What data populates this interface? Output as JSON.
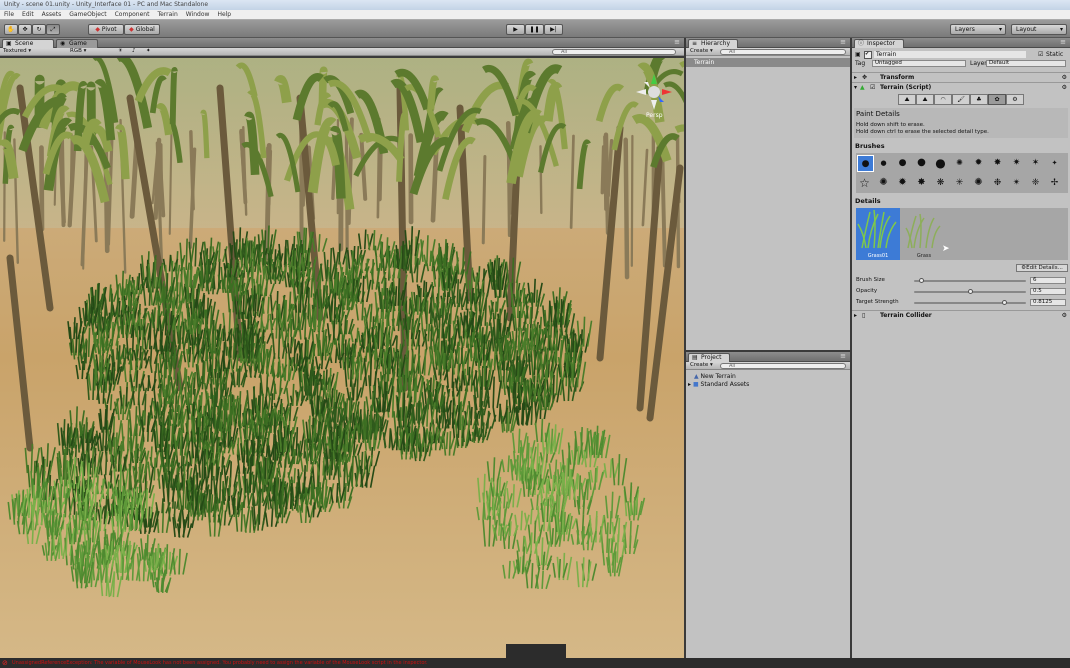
{
  "window": {
    "title": "Unity - scene 01.unity - Unity_Interface 01 - PC and Mac Standalone"
  },
  "menu": [
    "File",
    "Edit",
    "Assets",
    "GameObject",
    "Component",
    "Terrain",
    "Window",
    "Help"
  ],
  "toolbar": {
    "pivot": "Pivot",
    "global": "Global",
    "layers": "Layers",
    "layout": "Layout"
  },
  "scene": {
    "tab_scene": "Scene",
    "tab_game": "Game",
    "render_mode": "Textured",
    "color_mode": "RGB",
    "search_placeholder": "All",
    "gizmo_label": "Persp"
  },
  "hierarchy": {
    "tab": "Hierarchy",
    "create": "Create",
    "search_placeholder": "All",
    "items": [
      "Terrain"
    ]
  },
  "project": {
    "tab": "Project",
    "create": "Create",
    "search_placeholder": "All",
    "items": [
      "New Terrain",
      "Standard Assets"
    ]
  },
  "inspector": {
    "tab": "Inspector",
    "object_name": "Terrain",
    "static_label": "Static",
    "tag_label": "Tag",
    "tag_value": "Untagged",
    "layer_label": "Layer",
    "layer_value": "Default",
    "transform": "Transform",
    "terrain_script": "Terrain (Script)",
    "paint_title": "Paint Details",
    "help_line1": "Hold down shift to erase.",
    "help_line2": "Hold down ctrl to erase the selected detail type.",
    "brushes_label": "Brushes",
    "details_label": "Details",
    "detail_items": [
      "Grass01",
      "Grass"
    ],
    "edit_details": "Edit Details...",
    "params": [
      {
        "label": "Brush Size",
        "value": "6",
        "fraction": 0.05
      },
      {
        "label": "Opacity",
        "value": "0.5",
        "fraction": 0.5
      },
      {
        "label": "Target Strength",
        "value": "0.8125",
        "fraction": 0.8125
      }
    ],
    "terrain_collider": "Terrain Collider"
  },
  "status": {
    "message": "UnassignedReferenceException: The variable of MouseLook has not been assigned. You probably need to assign the variable of the MouseLook script in the inspector."
  },
  "colors": {
    "selection": "#3d7bd6",
    "error": "#cc1111"
  }
}
